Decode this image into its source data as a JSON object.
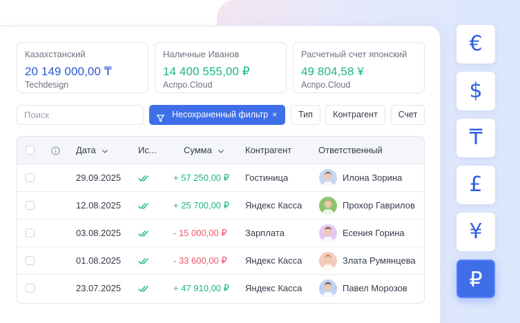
{
  "accounts": [
    {
      "title": "Казахстанский",
      "amount": "20 149 000,00 ₸",
      "sub": "Techdesign",
      "color": "#2a56d6"
    },
    {
      "title": "Наличные Иванов",
      "amount": "14 400 555,00 ₽",
      "sub": "Аспро.Cloud",
      "color": "#1bb38a"
    },
    {
      "title": "Расчетный счет японский",
      "amount": "49 804,58 ¥",
      "sub": "Аспро.Cloud",
      "color": "#1bb38a"
    }
  ],
  "search": {
    "placeholder": "Поиск"
  },
  "filter": {
    "label": "Несохраненный фильтр",
    "close": "×"
  },
  "filter_buttons": [
    "Тип",
    "Контрагент",
    "Счет"
  ],
  "table": {
    "headers": {
      "info": "i",
      "date": "Дата",
      "status": "Ис...",
      "sum": "Сумма",
      "counterparty": "Контрагент",
      "responsible": "Ответственный"
    },
    "rows": [
      {
        "date": "29.09.2025",
        "sum": "+ 57 250,00 ₽",
        "type": "pos",
        "counterparty": "Гостиница",
        "responsible": "Илона Зорина",
        "avatar_bg": "#c7d7f0",
        "avatar_fg": "#8a5a44"
      },
      {
        "date": "12.08.2025",
        "sum": "+ 25 700,00 ₽",
        "type": "pos",
        "counterparty": "Яндекс Касса",
        "responsible": "Прохор Гаврилов",
        "avatar_bg": "#8fc46f",
        "avatar_fg": "#d9a383"
      },
      {
        "date": "03.08.2025",
        "sum": "- 15 000,00 ₽",
        "type": "neg",
        "counterparty": "Зарплата",
        "responsible": "Есения Горина",
        "avatar_bg": "#e3c9f0",
        "avatar_fg": "#7a3b2c"
      },
      {
        "date": "01.08.2025",
        "sum": "- 33 600,00 ₽",
        "type": "neg",
        "counterparty": "Яндекс Касса",
        "responsible": "Злата Румянцева",
        "avatar_bg": "#f4cdbd",
        "avatar_fg": "#c9825d"
      },
      {
        "date": "23.07.2025",
        "sum": "+ 47 910,00 ₽",
        "type": "pos",
        "counterparty": "Яндекс Касса",
        "responsible": "Павел Морозов",
        "avatar_bg": "#bcd3f2",
        "avatar_fg": "#5a4032"
      }
    ]
  },
  "currencies": [
    {
      "symbol": "€",
      "name": "euro-icon",
      "active": false
    },
    {
      "symbol": "$",
      "name": "dollar-icon",
      "active": false
    },
    {
      "symbol": "₸",
      "name": "tenge-icon",
      "active": false
    },
    {
      "symbol": "£",
      "name": "pound-icon",
      "active": false
    },
    {
      "symbol": "¥",
      "name": "yen-icon",
      "active": false
    },
    {
      "symbol": "₽",
      "name": "ruble-icon",
      "active": true
    }
  ],
  "colors": {
    "accent": "#3e6ee8",
    "positive": "#1bb38a",
    "negative": "#f0566b"
  }
}
